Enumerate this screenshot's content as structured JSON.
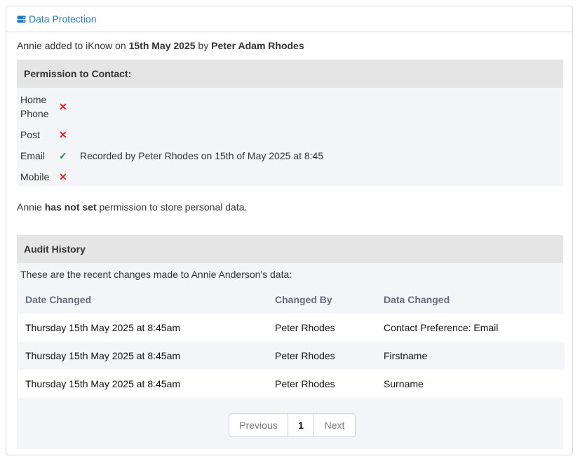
{
  "panel": {
    "title": "Data Protection"
  },
  "added": {
    "prefix": "Annie added to iKnow on",
    "date": "15th May 2025",
    "by_word": "by",
    "by_name": "Peter Adam Rhodes"
  },
  "permissions": {
    "header": "Permission to Contact:",
    "items": [
      {
        "label": "Home Phone",
        "granted": false,
        "mark": "✕",
        "note": ""
      },
      {
        "label": "Post",
        "granted": false,
        "mark": "✕",
        "note": ""
      },
      {
        "label": "Email",
        "granted": true,
        "mark": "✓",
        "note": "Recorded by Peter Rhodes on 15th of May 2025 at 8:45"
      },
      {
        "label": "Mobile",
        "granted": false,
        "mark": "✕",
        "note": ""
      }
    ]
  },
  "store": {
    "prefix": "Annie",
    "bold": "has not set",
    "suffix": "permission to store personal data."
  },
  "audit": {
    "header": "Audit History",
    "intro": "These are the recent changes made to Annie Anderson's data:",
    "columns": [
      "Date Changed",
      "Changed By",
      "Data Changed"
    ],
    "rows": [
      [
        "Thursday 15th May 2025 at 8:45am",
        "Peter Rhodes",
        "Contact Preference: Email"
      ],
      [
        "Thursday 15th May 2025 at 8:45am",
        "Peter Rhodes",
        "Firstname"
      ],
      [
        "Thursday 15th May 2025 at 8:45am",
        "Peter Rhodes",
        "Surname"
      ]
    ]
  },
  "pagination": {
    "previous": "Previous",
    "current": "1",
    "next": "Next"
  },
  "colors": {
    "accent": "#2c7bc1",
    "cross": "#e0241b",
    "tick": "#2b8a3e"
  }
}
